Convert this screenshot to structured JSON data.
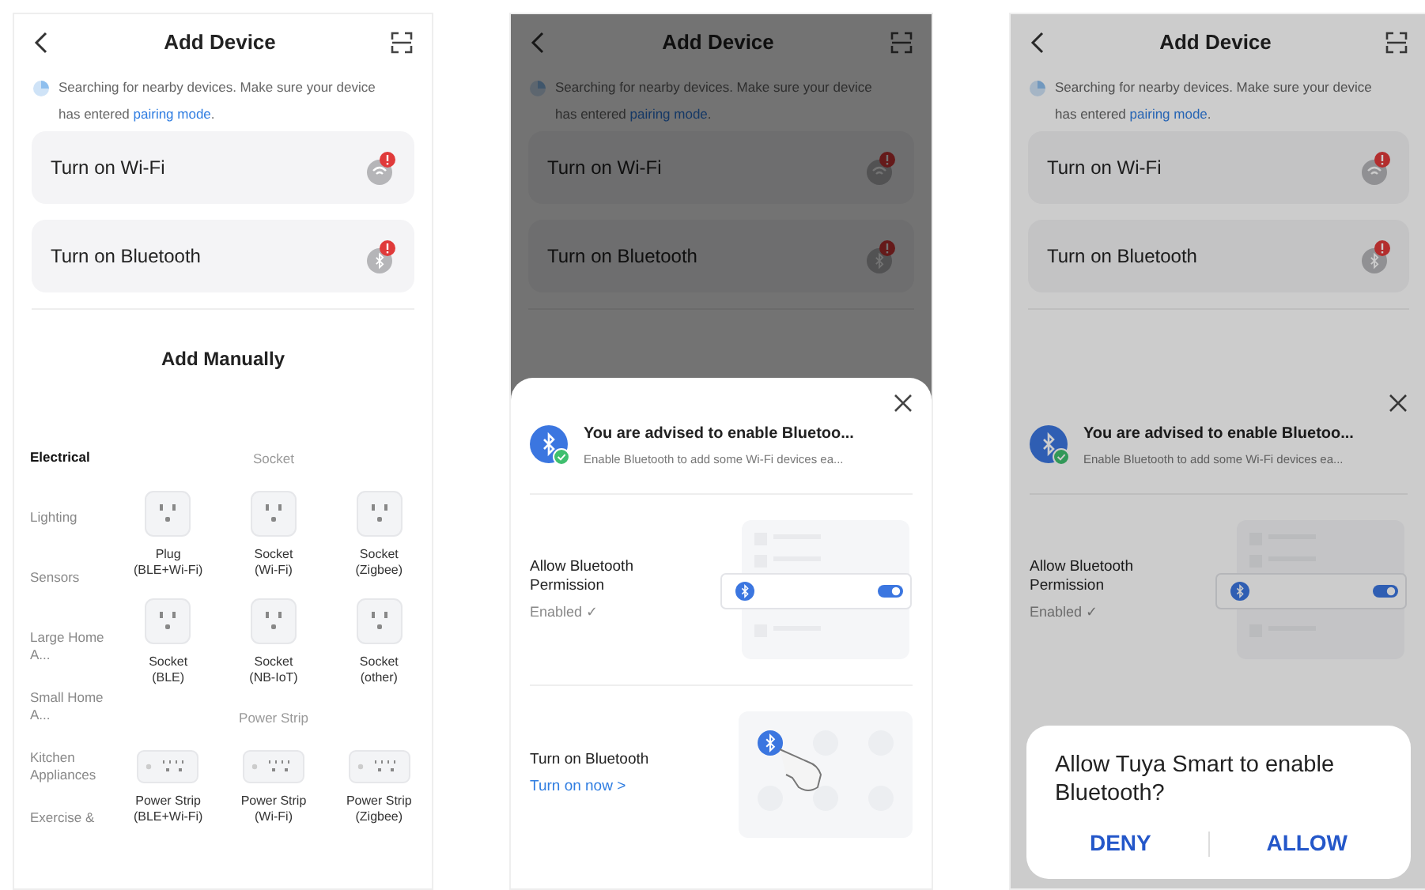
{
  "screens": [
    {
      "dimmed": false,
      "header": {
        "title": "Add Device"
      },
      "notice": {
        "text": "Searching for nearby devices. Make sure your device has entered ",
        "link": "pairing mode",
        "after": "."
      },
      "toggles": [
        {
          "kind": "wifi",
          "label": "Turn on Wi-Fi"
        },
        {
          "kind": "bluetooth",
          "label": "Turn on Bluetooth"
        }
      ],
      "manual": {
        "title": "Add Manually",
        "categories": [
          {
            "label": "Electrical",
            "selected": true
          },
          {
            "label": "Lighting",
            "selected": false
          },
          {
            "label": "Sensors",
            "selected": false
          },
          {
            "label": "Large Home A...",
            "selected": false
          },
          {
            "label": "Small Home A...",
            "selected": false
          },
          {
            "label": "Kitchen Appliances",
            "selected": false
          },
          {
            "label": "Exercise &",
            "selected": false
          }
        ],
        "groups": [
          {
            "title": "Socket",
            "devices": [
              {
                "kind": "socket",
                "lines": [
                  "Plug",
                  "(BLE+Wi-Fi)"
                ]
              },
              {
                "kind": "socket",
                "lines": [
                  "Socket",
                  "(Wi-Fi)"
                ]
              },
              {
                "kind": "socket",
                "lines": [
                  "Socket",
                  "(Zigbee)"
                ]
              },
              {
                "kind": "socket",
                "lines": [
                  "Socket",
                  "(BLE)"
                ]
              },
              {
                "kind": "socket",
                "lines": [
                  "Socket",
                  "(NB-IoT)"
                ]
              },
              {
                "kind": "socket",
                "lines": [
                  "Socket",
                  "(other)"
                ]
              }
            ]
          },
          {
            "title": "Power Strip",
            "devices": [
              {
                "kind": "power_strip",
                "lines": [
                  "Power Strip",
                  "(BLE+Wi-Fi)"
                ]
              },
              {
                "kind": "power_strip",
                "lines": [
                  "Power Strip",
                  "(Wi-Fi)"
                ]
              },
              {
                "kind": "power_strip",
                "lines": [
                  "Power Strip",
                  "(Zigbee)"
                ]
              }
            ]
          }
        ]
      }
    },
    {
      "dimmed": true,
      "header": {
        "title": "Add Device"
      },
      "notice": {
        "text": "Searching for nearby devices. Make sure your device has entered ",
        "link": "pairing mode",
        "after": "."
      },
      "toggles": [
        {
          "kind": "wifi",
          "label": "Turn on Wi-Fi"
        },
        {
          "kind": "bluetooth",
          "label": "Turn on Bluetooth"
        }
      ],
      "sheet": {
        "title": "You are advised to enable Bluetoo...",
        "subtitle": "Enable Bluetooth to add some Wi-Fi devices ea...",
        "steps": [
          {
            "kind": "permission",
            "title": "Allow Bluetooth Permission",
            "status": "Enabled ✓"
          },
          {
            "kind": "turn_on",
            "title": "Turn on Bluetooth",
            "link": "Turn on now >"
          }
        ]
      }
    },
    {
      "dimmed": true,
      "header": {
        "title": "Add Device"
      },
      "notice": {
        "text": "Searching for nearby devices. Make sure your device has entered ",
        "link": "pairing mode",
        "after": "."
      },
      "toggles": [
        {
          "kind": "wifi",
          "label": "Turn on Wi-Fi"
        },
        {
          "kind": "bluetooth",
          "label": "Turn on Bluetooth"
        }
      ],
      "sheet": {
        "title": "You are advised to enable Bluetoo...",
        "subtitle": "Enable Bluetooth to add some Wi-Fi devices ea...",
        "steps": [
          {
            "kind": "permission",
            "title": "Allow Bluetooth Permission",
            "status": "Enabled ✓"
          }
        ]
      },
      "dialog": {
        "message": "Allow Tuya Smart to enable Bluetooth?",
        "buttons": [
          "DENY",
          "ALLOW"
        ]
      }
    }
  ]
}
